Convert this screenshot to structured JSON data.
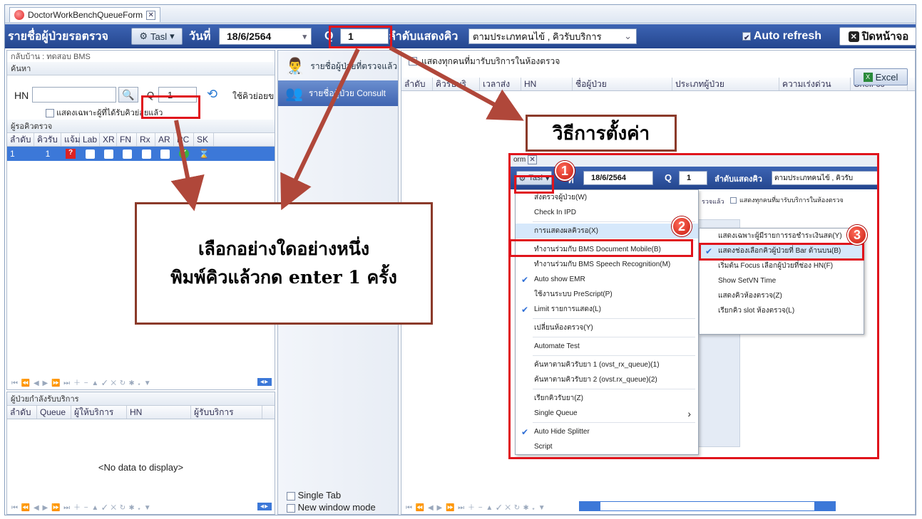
{
  "window": {
    "tab_title": "DoctorWorkBenchQueueForm",
    "close_glyph": "✕"
  },
  "toolbar": {
    "title": "รายชื่อผู้ป่วยรอตรวจ",
    "task_button": "Tasl",
    "date_label": "วันที่",
    "date_value": "18/6/2564",
    "q_label": "Q",
    "q_value": "1",
    "order_label": "ลำดับแสดงคิว",
    "order_value": "ตามประเภทคนไข้ , คิวรับบริการ",
    "auto_refresh": "Auto refresh",
    "close_button": "ปิดหน้าจอ"
  },
  "left_panel": {
    "back_home": "กลับบ้าน : ทดสอบ BMS",
    "search_header": "ค้นหา",
    "hn_label": "HN",
    "q_label": "Q",
    "q_value": "1",
    "use_queue_label": "ใช้คิวย่อยข",
    "only_received_label": "แสดงเฉพาะผู้ที่ได้รับคิวย่อยแล้ว",
    "waiting_header": "ผู้รอคิวตรวจ",
    "waiting_columns": [
      "ลำดับ",
      "คิวรับ",
      "แจ้ม",
      "Lab",
      "XR",
      "FN",
      "Rx",
      "AR",
      "RC",
      "SK"
    ],
    "waiting_row": {
      "order": "1",
      "queue": "1"
    },
    "serving_header": "ผู้ป่วยกำลังรับบริการ",
    "serving_columns": [
      "ลำดับ",
      "Queue",
      "ผู้ให้บริการ",
      "HN",
      "ผู้รับบริการ"
    ],
    "no_data": "<No data to display>"
  },
  "middle_panel": {
    "btn_examined": "รายชื่อผู้ป่วยที่ตรวจแล้ว",
    "btn_consult": "รายชื่อผู้ป่วย Consult",
    "single_tab": "Single Tab",
    "new_window": "New window mode"
  },
  "right_panel": {
    "show_all_label": "แสดงทุกคนที่มารับบริการในห้องตรวจ",
    "excel_button": "Excel",
    "columns": [
      "ลำดับ",
      "คิวรับบริ",
      "เวลาส่ง",
      "HN",
      "ชื่อผู้ป่วย",
      "ประเภทผู้ป่วย",
      "ความเร่งด่วน",
      "Cheif cc"
    ]
  },
  "callouts": {
    "settings_title": "วิธีการตั้งค่า",
    "instruction_line1": "เลือกอย่างใดอย่างหนึ่ง",
    "instruction_line2": "พิมพ์คิวแล้วกด enter 1 ครั้ง"
  },
  "inset": {
    "tab_fragment": "orm",
    "task_button": "Tasl",
    "date_fragment": "ที่",
    "date_value": "18/6/2564",
    "q_label": "Q",
    "q_value": "1",
    "order_label": "ลำดับแสดงคิว",
    "order_value": "ตามประเภทคนไข้ , คิวรับ",
    "examined_fragment": "รวจแล้ว",
    "show_all_label": "แสดงทุกคนที่มารับบริการในห้องตรวจ",
    "badges": [
      "1",
      "2",
      "3"
    ],
    "menu_items": [
      {
        "label": "ส่งตรวจผู้ป่วย(W)",
        "checked": false
      },
      {
        "label": "Check In IPD",
        "checked": false
      },
      {
        "label": "การแสดงผลคิวรอ(X)",
        "checked": false,
        "highlight": true
      },
      {
        "label": "ทำงานร่วมกับ BMS Document Mobile(B)",
        "checked": false
      },
      {
        "label": "ทำงานร่วมกับ BMS Speech Recognition(M)",
        "checked": false
      },
      {
        "label": "Auto show EMR",
        "checked": true
      },
      {
        "label": "ใช้งานระบบ PreScript(P)",
        "checked": false
      },
      {
        "label": "Limit รายการแสดง(L)",
        "checked": true
      },
      {
        "label": "เปลี่ยนห้องตรวจ(Y)",
        "checked": false
      },
      {
        "label": "Automate Test",
        "checked": false
      },
      {
        "label": "ค้นหาตามคิวรับยา 1 (ovst_rx_queue)(1)",
        "checked": false
      },
      {
        "label": "ค้นหาตามคิวรับยา 2 (ovst.rx_queue)(2)",
        "checked": false
      },
      {
        "label": "เรียกคิวรับยา(Z)",
        "checked": false
      },
      {
        "label": "Single Queue",
        "checked": false,
        "submenu": true
      },
      {
        "label": "Auto Hide Splitter",
        "checked": true
      },
      {
        "label": "Script",
        "checked": false
      }
    ],
    "submenu_items": [
      {
        "label": "แสดงเฉพาะผู้มีรายการรอชำระเงินสด(Y)",
        "checked": false
      },
      {
        "label": "แสดงช่องเลือกคิวผู้ป่วยที่ Bar ด้านบน(B)",
        "checked": true,
        "highlight": true
      },
      {
        "label": "เริ่มต้น Focus เลือกผู้ป่วยที่ช่อง HN(F)",
        "checked": false
      },
      {
        "label": "Show SetVN Time",
        "checked": false
      },
      {
        "label": "แสดงคิวห้องตรวจ(Z)",
        "checked": false
      },
      {
        "label": "เรียกคิว slot ห้องตรวจ(L)",
        "checked": false
      }
    ],
    "submenu_arrow": "›"
  },
  "colors": {
    "toolbar": "#24468e",
    "highlight_red": "#e0141c",
    "callout_border": "#8b3a2a",
    "arrow": "#b0473a"
  }
}
